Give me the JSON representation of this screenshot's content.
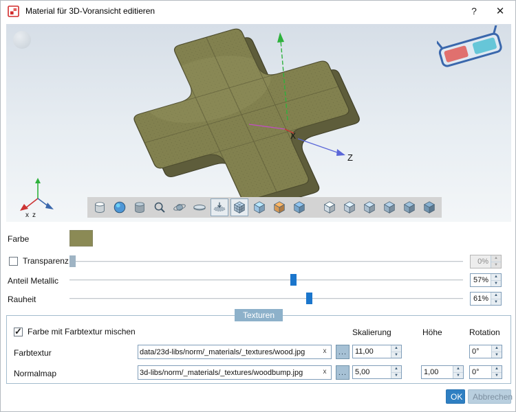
{
  "window": {
    "title": "Material für 3D-Voransicht editieren",
    "help_label": "?",
    "close_label": "✕"
  },
  "viewport": {
    "axis_labels": {
      "x": "X",
      "z": "Z"
    },
    "mini_axis_labels": {
      "x": "x",
      "z": "z"
    },
    "toolbar": {
      "items": [
        {
          "name": "shape-cylinder-icon",
          "type": "cylinder",
          "color": "#e3eaef"
        },
        {
          "name": "shape-sphere-icon",
          "type": "sphere",
          "color": "#4f97d6"
        },
        {
          "name": "shape-cube-icon",
          "type": "cylinder",
          "color": "#a9b7c1"
        },
        {
          "name": "zoom-icon",
          "type": "zoom",
          "color": "#3d5568"
        },
        {
          "name": "orbit-icon",
          "type": "orbit",
          "color": "#93aaba"
        },
        {
          "name": "turntable-icon",
          "type": "disc",
          "color": "#c6d0d8"
        },
        {
          "name": "clip-plane-icon",
          "type": "clip",
          "color": "#7d93a4",
          "pressed": true
        },
        {
          "name": "mesh-cube-icon",
          "type": "meshcube",
          "color": "#a6bcce",
          "pressed": true
        },
        {
          "name": "transparent-cube-icon",
          "type": "cube",
          "color": "#9cc4e4"
        },
        {
          "name": "textured-cube-icon",
          "type": "cube",
          "color": "#d99a55"
        },
        {
          "name": "shaded-cube-icon",
          "type": "cube",
          "color": "#7aa7cc"
        },
        {
          "name": "toolbar-separator",
          "type": "gap"
        },
        {
          "name": "light-preset-1-icon",
          "type": "cube",
          "color": "#d2dde5"
        },
        {
          "name": "light-preset-2-icon",
          "type": "cube",
          "color": "#bfcedb"
        },
        {
          "name": "light-preset-3-icon",
          "type": "cube",
          "color": "#acc0d0"
        },
        {
          "name": "light-preset-4-icon",
          "type": "cube",
          "color": "#99b2c6"
        },
        {
          "name": "light-preset-5-icon",
          "type": "cube",
          "color": "#86a4bb"
        },
        {
          "name": "light-preset-6-icon",
          "type": "cube",
          "color": "#7396b1"
        }
      ]
    }
  },
  "material": {
    "farbe_label": "Farbe",
    "color_swatch": "#8b8a55",
    "sliders": [
      {
        "label": "Transparenz",
        "has_checkbox": true,
        "checked": false,
        "value": "0%",
        "percent": 0,
        "disabled": true
      },
      {
        "label": "Anteil Metallic",
        "value": "57%",
        "percent": 57
      },
      {
        "label": "Rauheit",
        "value": "61%",
        "percent": 61
      }
    ]
  },
  "texturen": {
    "title": "Texturen",
    "mix_label": "Farbe mit Farbtextur mischen",
    "mix_checked": true,
    "headers": [
      "Skalierung",
      "Höhe",
      "Rotation"
    ],
    "rows": [
      {
        "label": "Farbtextur",
        "path": "data/23d-libs/norm/_materials/_textures/wood.jpg",
        "clear_label": "x",
        "browse_label": "...",
        "skalierung": "11,00",
        "rotation": "0°"
      },
      {
        "label": "Normalmap",
        "path": "3d-libs/norm/_materials/_textures/woodbump.jpg",
        "clear_label": "x",
        "browse_label": "...",
        "skalierung": "5,00",
        "hoehe": "1,00",
        "rotation": "0°"
      }
    ]
  },
  "footer": {
    "ok_label": "OK",
    "cancel_label": "Abbrechen"
  }
}
